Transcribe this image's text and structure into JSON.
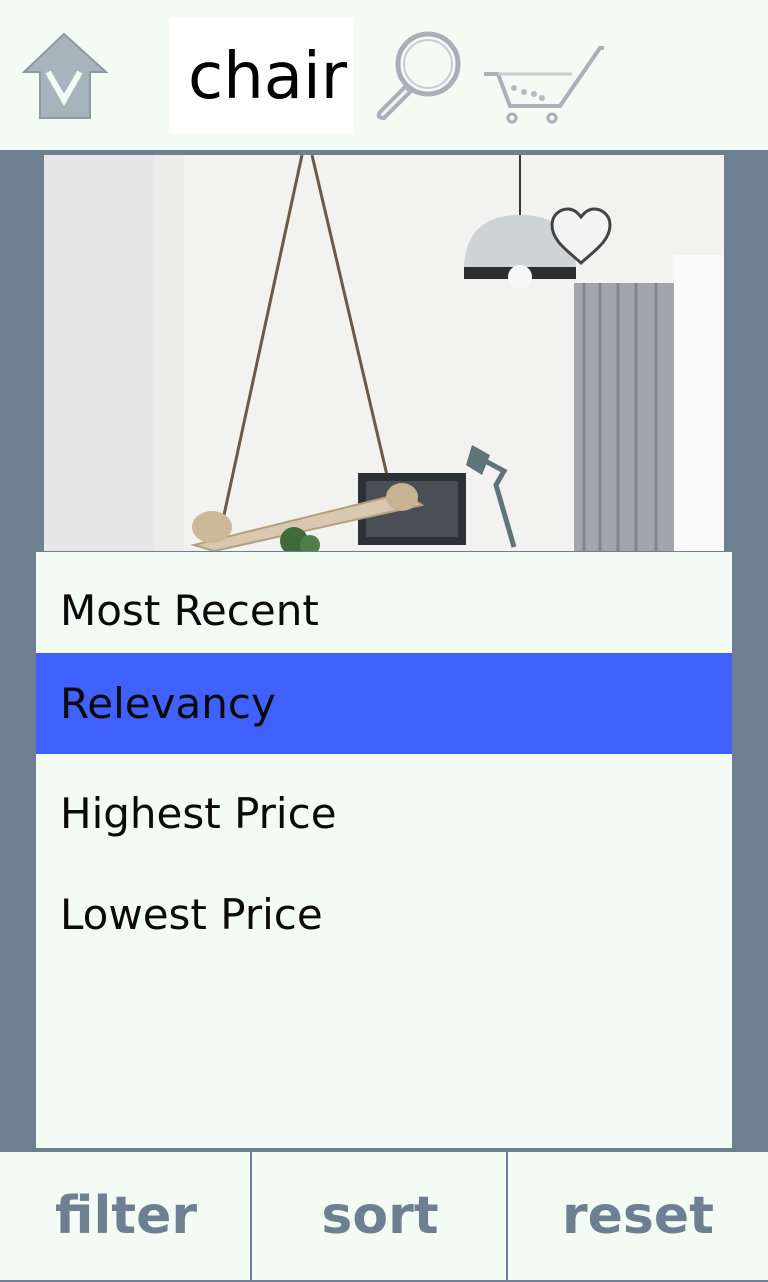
{
  "header": {
    "search_value": "chair",
    "icons": [
      "home-icon",
      "magnifier-icon",
      "cart-icon"
    ]
  },
  "product": {
    "favorite_icon": "heart-icon"
  },
  "sort_menu": {
    "options": [
      "Most Recent",
      "Relevancy",
      "Highest Price",
      "Lowest Price"
    ],
    "selected": "Relevancy",
    "selected_color": "#4161ff"
  },
  "footer": {
    "filter_label": "filter",
    "sort_label": "sort",
    "reset_label": "reset"
  },
  "colors": {
    "background": "#6f7f92",
    "panel": "#f3fbf5",
    "accent": "#4161ff",
    "footer_text": "#6e7f92"
  }
}
